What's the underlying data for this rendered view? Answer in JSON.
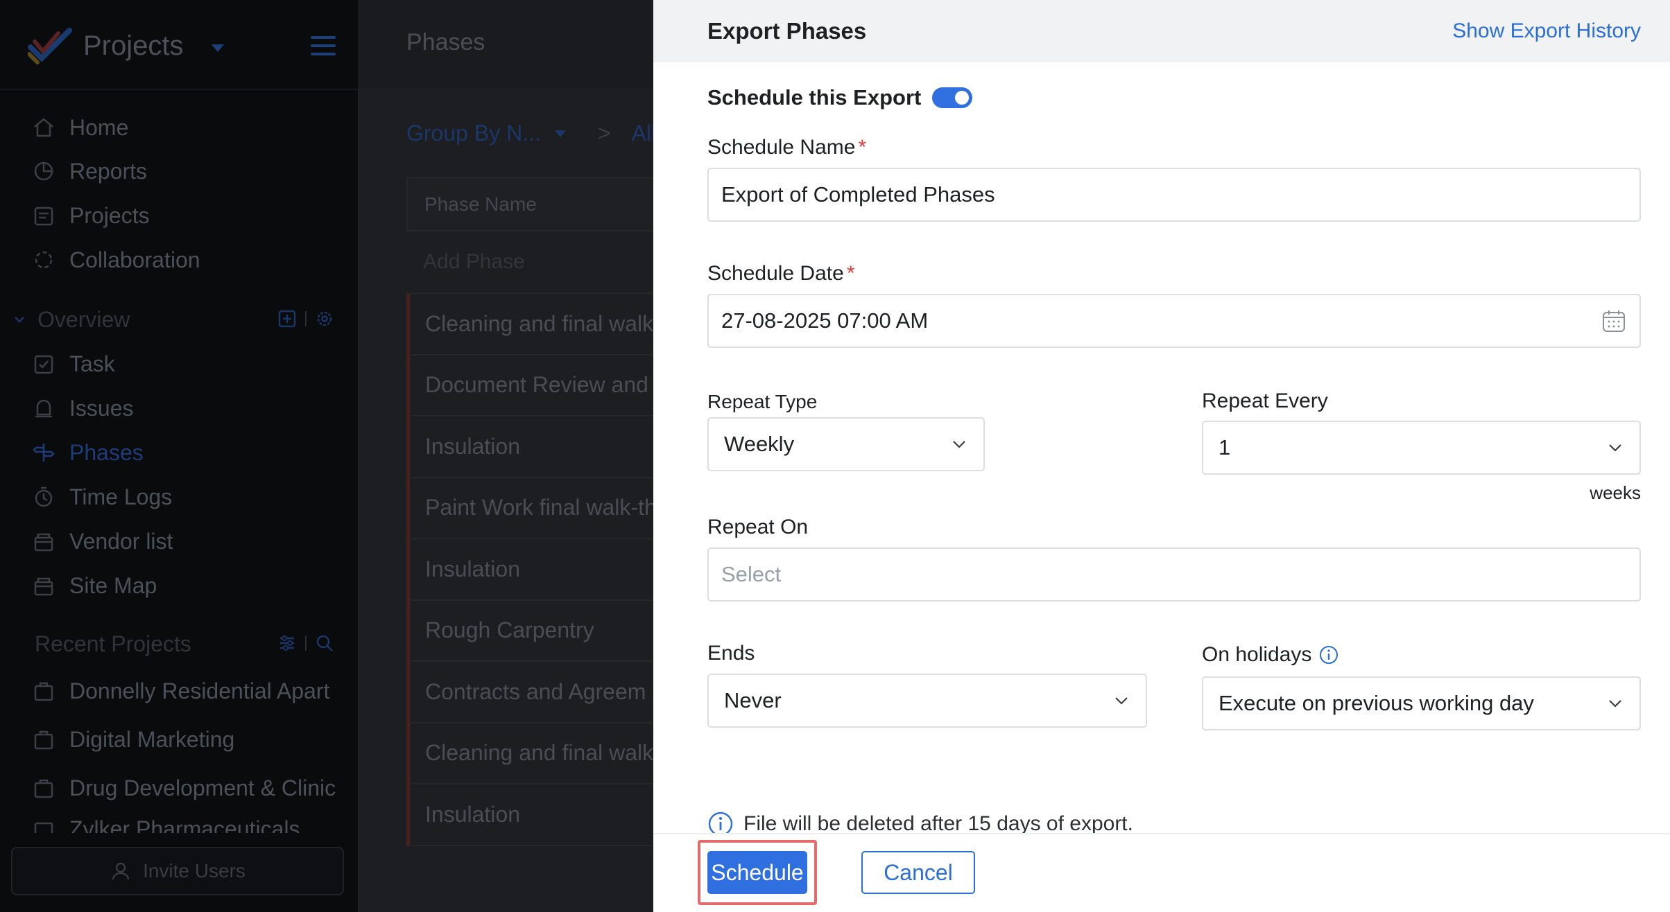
{
  "sidebar": {
    "app_title": "Projects",
    "nav": [
      {
        "label": "Home",
        "icon": "home-icon"
      },
      {
        "label": "Reports",
        "icon": "reports-icon"
      },
      {
        "label": "Projects",
        "icon": "projects-icon"
      },
      {
        "label": "Collaboration",
        "icon": "collaboration-icon"
      }
    ],
    "overview_heading": "Overview",
    "overview_items": [
      {
        "label": "Task",
        "icon": "task-icon"
      },
      {
        "label": "Issues",
        "icon": "issues-icon"
      },
      {
        "label": "Phases",
        "icon": "phases-icon",
        "active": true
      },
      {
        "label": "Time Logs",
        "icon": "time-logs-icon"
      },
      {
        "label": "Vendor list",
        "icon": "vendor-list-icon"
      },
      {
        "label": "Site Map",
        "icon": "site-map-icon"
      }
    ],
    "recent_heading": "Recent Projects",
    "recent_projects": [
      "Donnelly Residential Apart",
      "Digital Marketing",
      "Drug Development & Clinic",
      "Zylker Pharmaceuticals"
    ],
    "invite_label": "Invite Users"
  },
  "middle": {
    "title": "Phases",
    "group_by": "Group By N...",
    "breadcrumb_next": "All P",
    "column_header": "Phase Name",
    "add_placeholder": "Add Phase",
    "rows": [
      "Cleaning and final walk",
      "Document Review and",
      "Insulation",
      "Paint Work final walk-th",
      "Insulation",
      "Rough Carpentry",
      "Contracts and Agreem",
      "Cleaning and final walk",
      "Insulation"
    ]
  },
  "panel": {
    "title": "Export Phases",
    "history_link": "Show Export History",
    "schedule_toggle_label": "Schedule this Export",
    "schedule_toggle_on": true,
    "schedule_name_label": "Schedule Name",
    "required_mark": "*",
    "schedule_name_value": "Export of Completed Phases",
    "schedule_date_label": "Schedule Date",
    "schedule_date_value": "27-08-2025 07:00 AM",
    "repeat_type_label": "Repeat Type",
    "repeat_type_value": "Weekly",
    "repeat_every_label": "Repeat Every",
    "repeat_every_value": "1",
    "repeat_every_unit": "weeks",
    "repeat_on_label": "Repeat On",
    "repeat_on_placeholder": "Select",
    "ends_label": "Ends",
    "ends_value": "Never",
    "holidays_label": "On holidays",
    "holidays_value": "Execute on previous working day",
    "info_note": "File will be deleted after 15 days of export.",
    "schedule_button": "Schedule",
    "cancel_button": "Cancel"
  },
  "colors": {
    "accent": "#2f6fe0",
    "link": "#2b6fd6",
    "required": "#e03a3a",
    "highlight": "#e36b6b"
  }
}
